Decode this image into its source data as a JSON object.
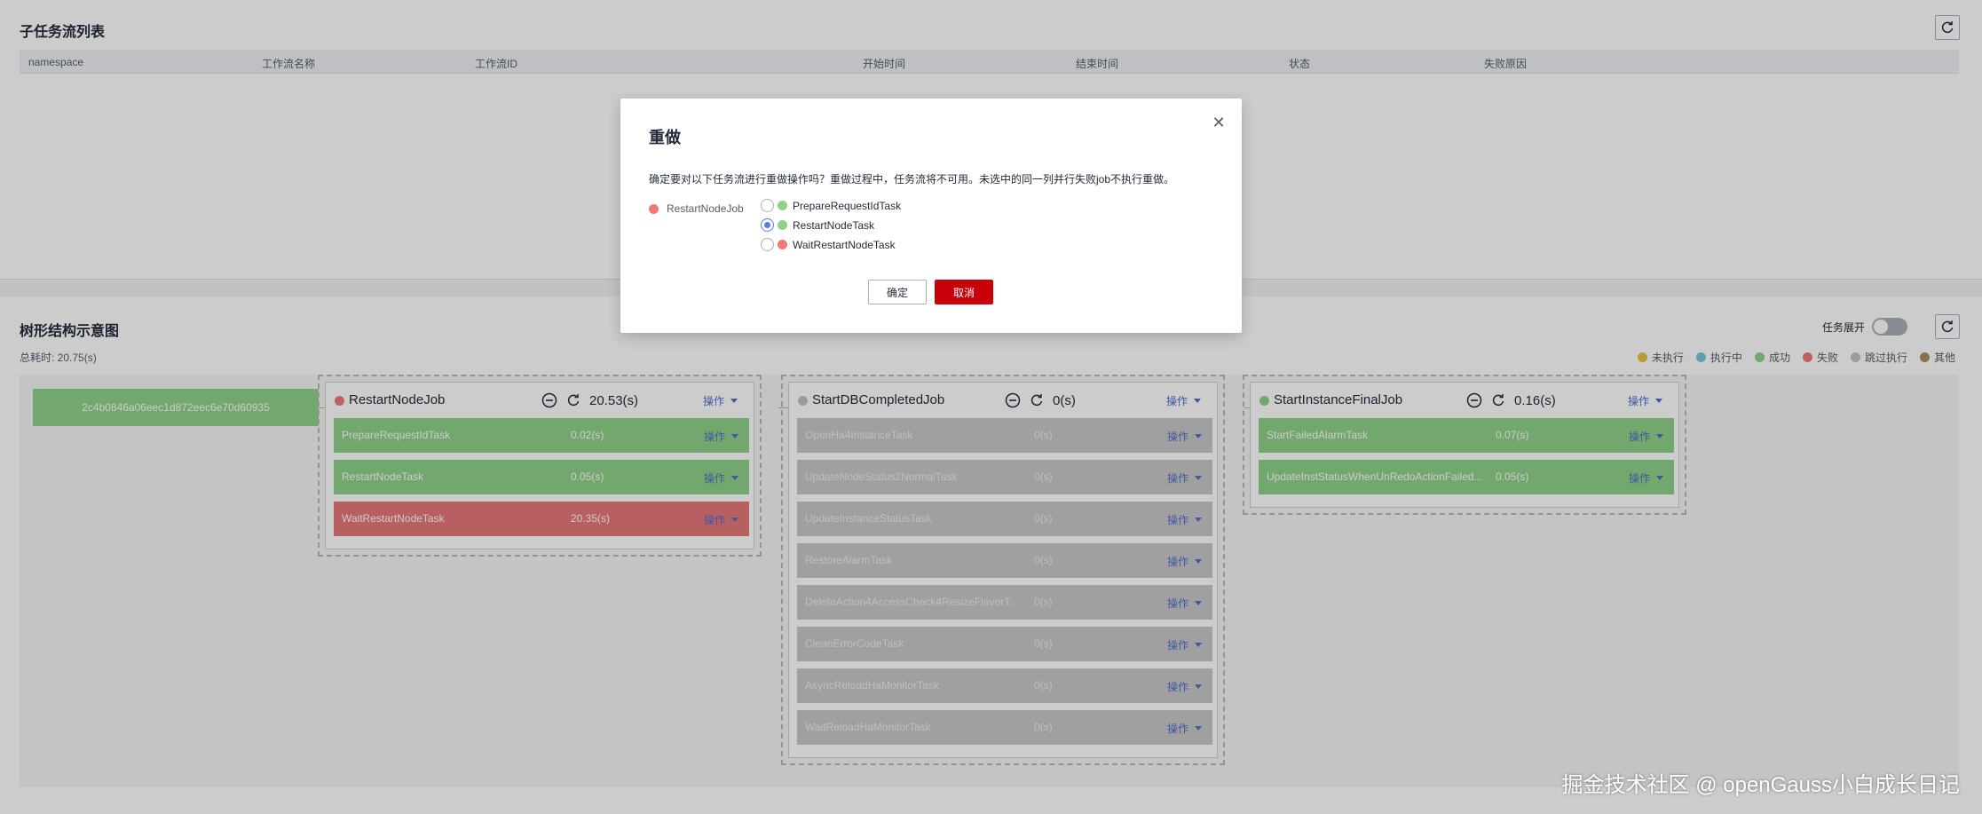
{
  "subflow_list": {
    "title": "子任务流列表",
    "columns": [
      "namespace",
      "工作流名称",
      "工作流ID",
      "开始时间",
      "结束时间",
      "状态",
      "失败原因"
    ]
  },
  "tree": {
    "title": "树形结构示意图",
    "total_time": "总耗时: 20.75(s)",
    "expand_toggle_label": "任务展开",
    "expand_toggle_on": false,
    "legend": [
      {
        "label": "未执行",
        "color": "#e3c53c"
      },
      {
        "label": "执行中",
        "color": "#7ec3e0"
      },
      {
        "label": "成功",
        "color": "#8fd18a"
      },
      {
        "label": "失败",
        "color": "#ef7a79"
      },
      {
        "label": "跳过执行",
        "color": "#c4c4c4"
      },
      {
        "label": "其他",
        "color": "#a58e62"
      }
    ],
    "root": {
      "label": "2c4b0846a06eec1d872eec6e70d60935"
    },
    "jobs": [
      {
        "name": "RestartNodeJob",
        "status_color": "#ef7a79",
        "duration": "20.53(s)",
        "op_label": "操作",
        "tasks": [
          {
            "name": "PrepareRequestIdTask",
            "time": "0.02(s)",
            "status": "success",
            "op_label": "操作"
          },
          {
            "name": "RestartNodeTask",
            "time": "0.05(s)",
            "status": "success",
            "op_label": "操作"
          },
          {
            "name": "WaitRestartNodeTask",
            "time": "20.35(s)",
            "status": "failed",
            "op_label": "操作"
          }
        ]
      },
      {
        "name": "StartDBCompletedJob",
        "status_color": "#c4c4c4",
        "duration": "0(s)",
        "op_label": "操作",
        "tasks": [
          {
            "name": "OpenHa4InstanceTask",
            "time": "0(s)",
            "status": "skipped",
            "op_label": "操作"
          },
          {
            "name": "UpdateNodeStatus2NormalTask",
            "time": "0(s)",
            "status": "skipped",
            "op_label": "操作"
          },
          {
            "name": "UpdateInstanceStatusTask",
            "time": "0(s)",
            "status": "skipped",
            "op_label": "操作"
          },
          {
            "name": "RestoreAlarmTask",
            "time": "0(s)",
            "status": "skipped",
            "op_label": "操作"
          },
          {
            "name": "DeleteAction4AccessCheck4ResizeFlavorT...",
            "time": "0(s)",
            "status": "skipped",
            "op_label": "操作"
          },
          {
            "name": "CleanErrorCodeTask",
            "time": "0(s)",
            "status": "skipped",
            "op_label": "操作"
          },
          {
            "name": "AsyncReloadHaMonitorTask",
            "time": "0(s)",
            "status": "skipped",
            "op_label": "操作"
          },
          {
            "name": "WaitReloadHaMonitorTask",
            "time": "0(s)",
            "status": "skipped",
            "op_label": "操作"
          }
        ]
      },
      {
        "name": "StartInstanceFinalJob",
        "status_color": "#8fd18a",
        "duration": "0.16(s)",
        "op_label": "操作",
        "tasks": [
          {
            "name": "StartFailedAlarmTask",
            "time": "0.07(s)",
            "status": "success",
            "op_label": "操作"
          },
          {
            "name": "UpdateInstStatusWhenUnRedoActionFailed...",
            "time": "0.05(s)",
            "status": "success",
            "op_label": "操作"
          }
        ]
      }
    ]
  },
  "dialog": {
    "title": "重做",
    "description": "确定要对以下任务流进行重做操作吗？重做过程中，任务流将不可用。未选中的同一列并行失败job不执行重做。",
    "job": {
      "name": "RestartNodeJob",
      "color": "#ef7a79"
    },
    "tasks": [
      {
        "name": "PrepareRequestIdTask",
        "color": "#8fd18a",
        "selected": false
      },
      {
        "name": "RestartNodeTask",
        "color": "#8fd18a",
        "selected": true
      },
      {
        "name": "WaitRestartNodeTask",
        "color": "#ef7a79",
        "selected": false
      }
    ],
    "confirm_label": "确定",
    "cancel_label": "取消"
  },
  "watermark": "掘金技术社区 @ openGauss小白成长日记"
}
